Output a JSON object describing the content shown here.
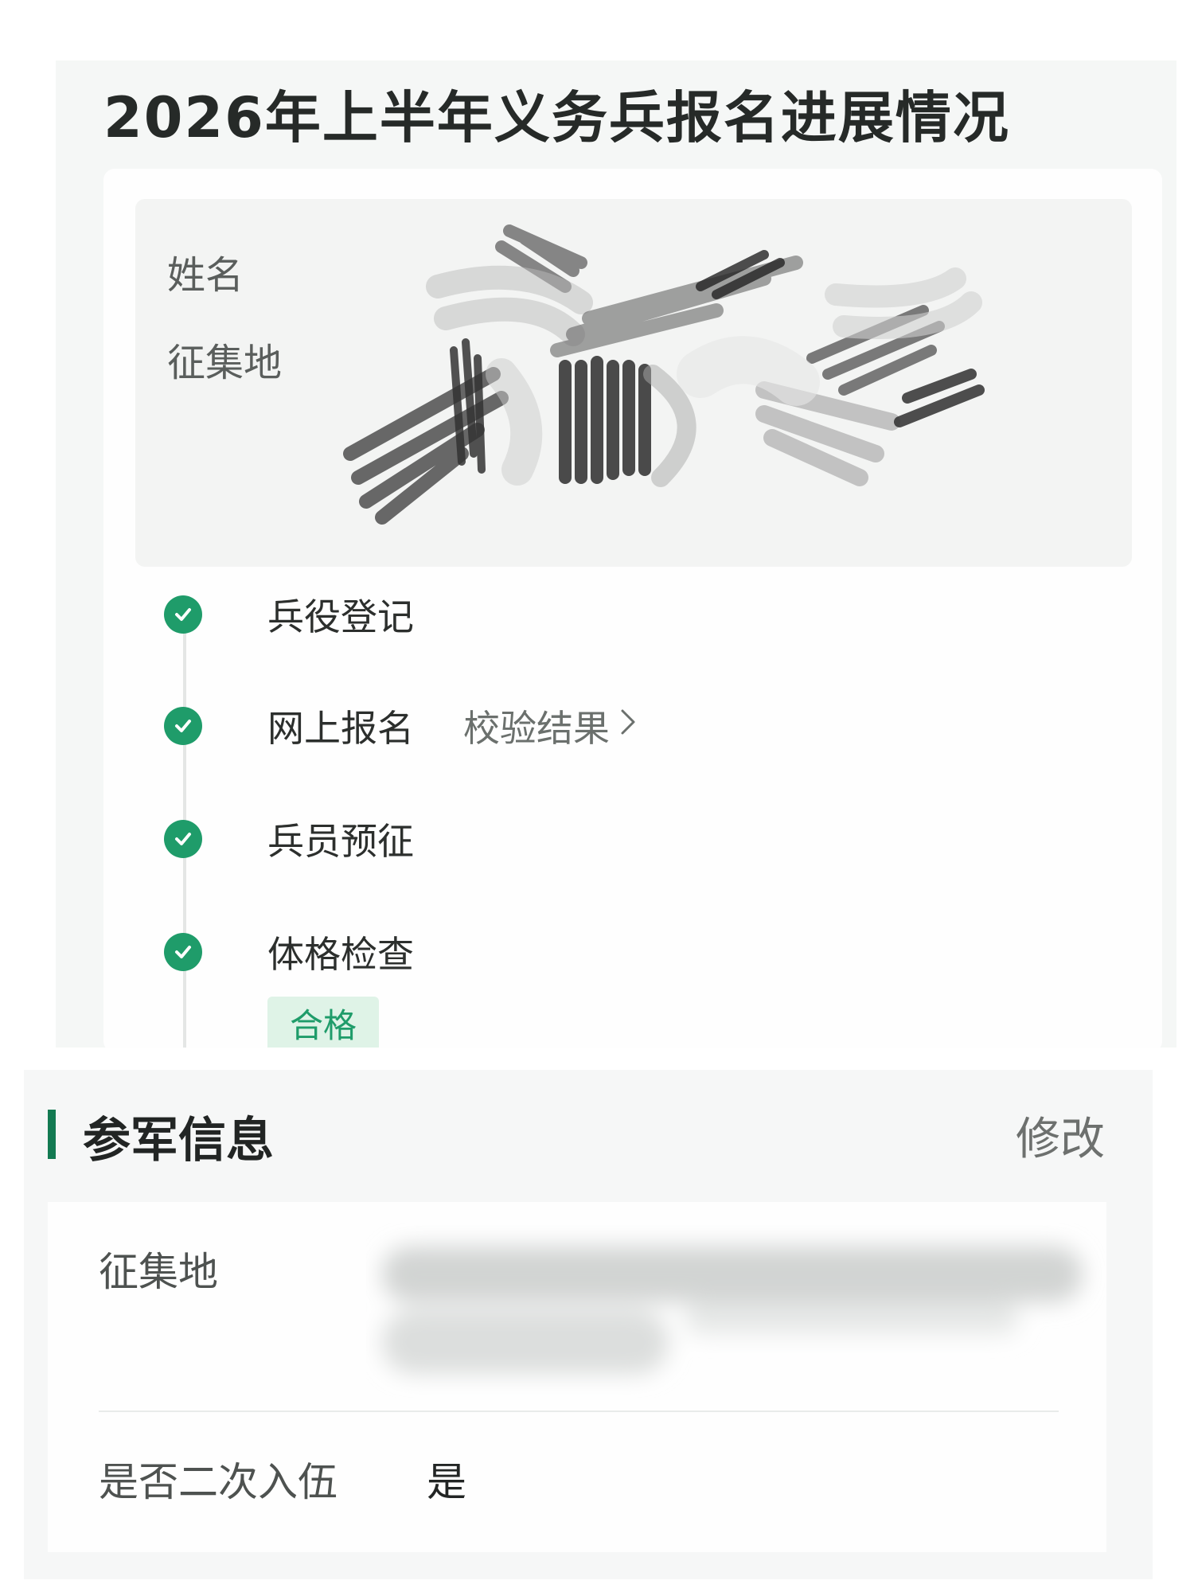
{
  "header": {
    "title": "2026年上半年义务兵报名进展情况"
  },
  "identity": {
    "name_label": "姓名",
    "region_label": "征集地"
  },
  "steps": [
    {
      "label": "兵役登记",
      "status": "completed"
    },
    {
      "label": "网上报名",
      "status": "completed",
      "link_label": "校验结果"
    },
    {
      "label": "兵员预征",
      "status": "completed"
    },
    {
      "label": "体格检查",
      "status": "completed",
      "result": "合格"
    }
  ],
  "enlistment_info": {
    "title": "参军信息",
    "edit_label": "修改",
    "region_label": "征集地",
    "reenlist_label": "是否二次入伍",
    "reenlist_value": "是"
  },
  "colors": {
    "accent_green": "#1f9c6a",
    "section_bar": "#137a52",
    "panel_bg": "#f5f7f6"
  },
  "icons": {
    "step_status": "check-circle-icon",
    "link_arrow": "chevron-right-icon"
  }
}
